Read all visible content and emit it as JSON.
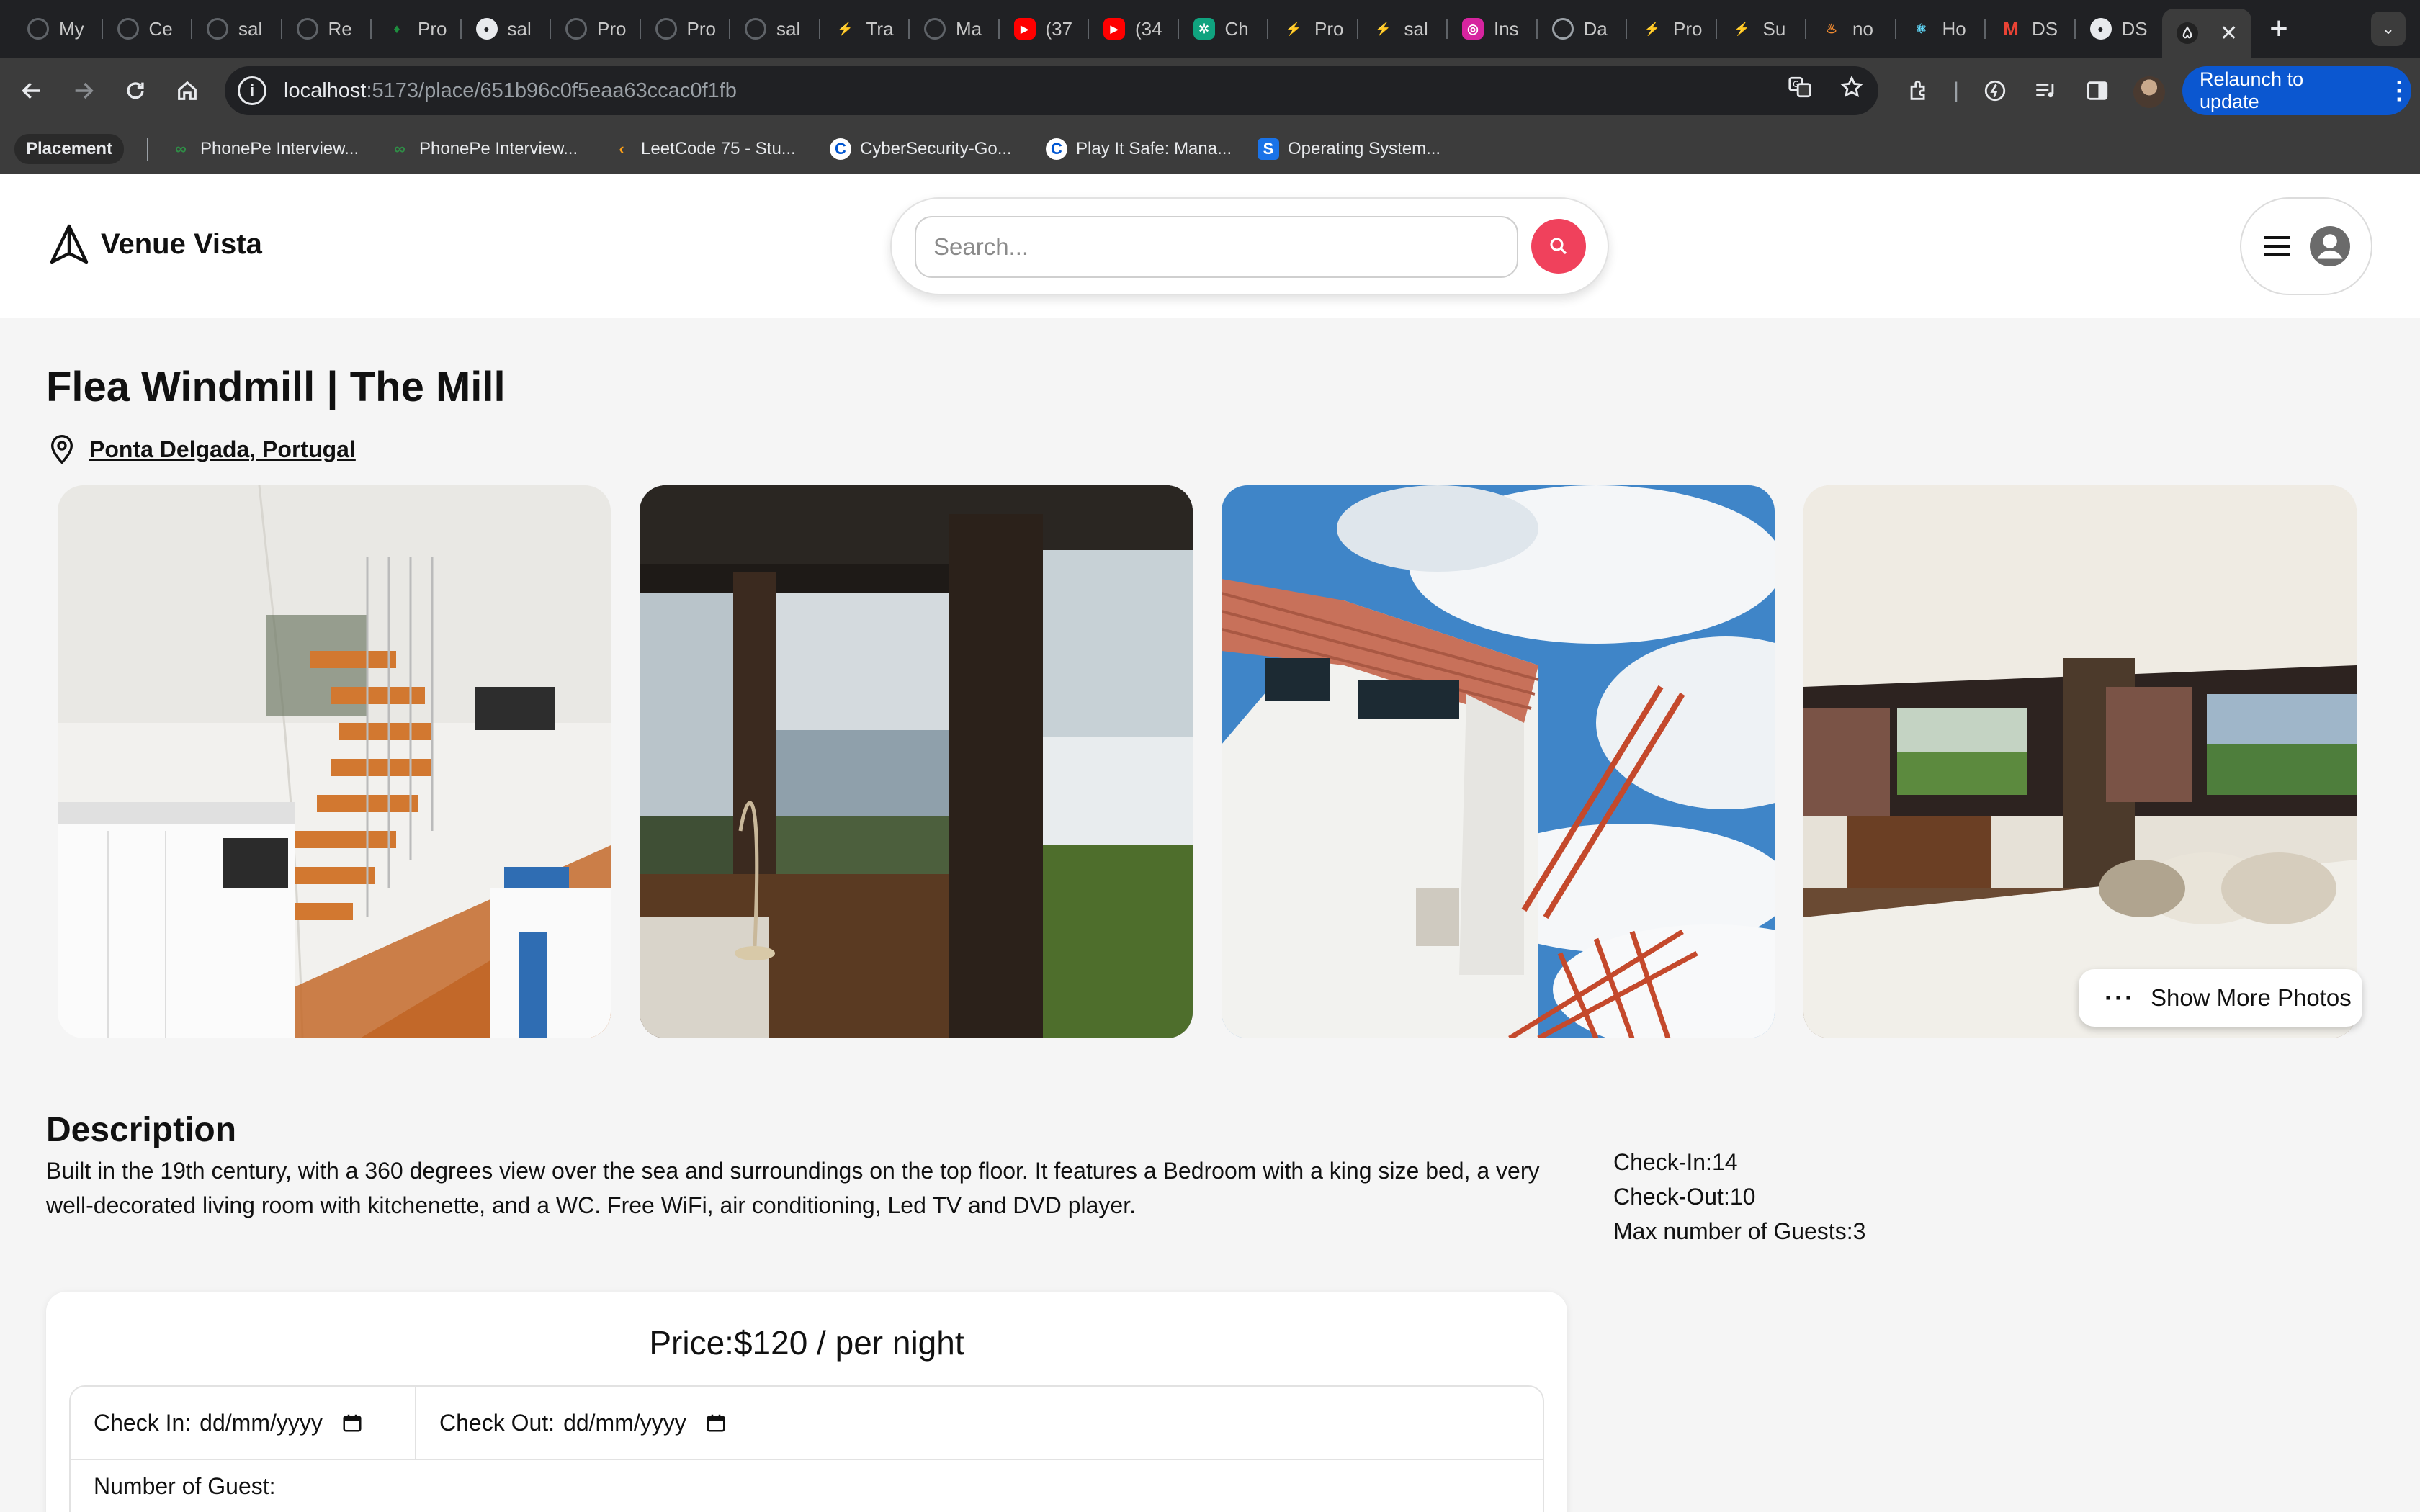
{
  "browser": {
    "tabs": [
      {
        "label": "My",
        "icon": "globe-dark-icon",
        "color": "#5f6368"
      },
      {
        "label": "Ce",
        "icon": "globe-dark-icon",
        "color": "#5f6368"
      },
      {
        "label": "sal",
        "icon": "dollar-circle-icon",
        "color": "#5f6368"
      },
      {
        "label": "Re",
        "icon": "dollar-circle-icon",
        "color": "#5f6368"
      },
      {
        "label": "Pro",
        "icon": "leaf-icon",
        "color": "#1e8e3e"
      },
      {
        "label": "sal",
        "icon": "github-icon",
        "color": "#e8eaed"
      },
      {
        "label": "Pro",
        "icon": "circle-icon",
        "color": "#5f6368"
      },
      {
        "label": "Pro",
        "icon": "dollar-circle-icon",
        "color": "#5f6368"
      },
      {
        "label": "sal",
        "icon": "dollar-circle-icon",
        "color": "#5f6368"
      },
      {
        "label": "Tra",
        "icon": "bolt-icon",
        "color": "#f5a623"
      },
      {
        "label": "Ma",
        "icon": "dollar-circle-icon",
        "color": "#5f6368"
      },
      {
        "label": "(37",
        "icon": "youtube-icon",
        "color": "#ff0000"
      },
      {
        "label": "(34",
        "icon": "youtube-icon",
        "color": "#ff0000"
      },
      {
        "label": "Ch",
        "icon": "chatgpt-icon",
        "color": "#10a37f"
      },
      {
        "label": "Pro",
        "icon": "bolt-icon",
        "color": "#f5a623"
      },
      {
        "label": "sal",
        "icon": "bolt-icon",
        "color": "#f5a623"
      },
      {
        "label": "Ins",
        "icon": "instagram-icon",
        "color": "#d6249f"
      },
      {
        "label": "Da",
        "icon": "globe-icon",
        "color": "#9aa0a6"
      },
      {
        "label": "Pro",
        "icon": "bolt-icon",
        "color": "#f5a623"
      },
      {
        "label": "Su",
        "icon": "bolt-icon",
        "color": "#f5a623"
      },
      {
        "label": "no",
        "icon": "flame-icon",
        "color": "#f28b30"
      },
      {
        "label": "Ho",
        "icon": "react-icon",
        "color": "#61dafb"
      },
      {
        "label": "DS",
        "icon": "gmail-icon",
        "color": "#ea4335"
      },
      {
        "label": "DS",
        "icon": "github-icon",
        "color": "#e8eaed"
      }
    ],
    "active_tab_icon": "airbnb-icon",
    "url_host": "localhost",
    "url_path": ":5173/place/651b96c0f5eaa63ccac0f1fb",
    "relaunch_label": "Relaunch to update",
    "bookmarks": {
      "placement": "Placement",
      "items": [
        {
          "label": "PhonePe Interview...",
          "icon": "gfg-icon",
          "color": "#2f8d46"
        },
        {
          "label": "PhonePe Interview...",
          "icon": "gfg-icon",
          "color": "#2f8d46"
        },
        {
          "label": "LeetCode 75 - Stu...",
          "icon": "leetcode-icon",
          "color": "#ffa116"
        },
        {
          "label": "CyberSecurity-Go...",
          "icon": "coursera-icon",
          "color": "#0056d2"
        },
        {
          "label": "Play It Safe: Mana...",
          "icon": "coursera-icon",
          "color": "#0056d2"
        },
        {
          "label": "Operating System...",
          "icon": "scaler-icon",
          "color": "#1a73e8"
        }
      ]
    }
  },
  "header": {
    "brand": "Venue Vista",
    "search_placeholder": "Search..."
  },
  "place": {
    "title": "Flea Windmill | The Mill",
    "location": "Ponta Delgada, Portugal",
    "show_more_label": "Show More Photos",
    "photos": [
      {
        "name": "photo-kitchen-stairs"
      },
      {
        "name": "photo-window-sea-view"
      },
      {
        "name": "photo-windmill-exterior"
      },
      {
        "name": "photo-bedroom"
      }
    ],
    "description_heading": "Description",
    "description": "Built in the 19th century, with a 360 degrees view over the sea and surroundings on the top floor. It features a Bedroom with a king size bed, a very well-decorated living room with kitchenette, and a WC. Free WiFi, air conditioning, Led TV and DVD player.",
    "check_in": "Check-In:14",
    "check_out": "Check-Out:10",
    "max_guests": "Max number of Guests:3"
  },
  "booking": {
    "price": "Price:$120 / per night",
    "check_in_label": "Check In:",
    "check_in_value": "dd/mm/yyyy",
    "check_out_label": "Check Out:",
    "check_out_value": "dd/mm/yyyy",
    "guests_label": "Number of Guest:"
  },
  "colors": {
    "accent": "#f0415c",
    "relaunch": "#0b57d0"
  }
}
